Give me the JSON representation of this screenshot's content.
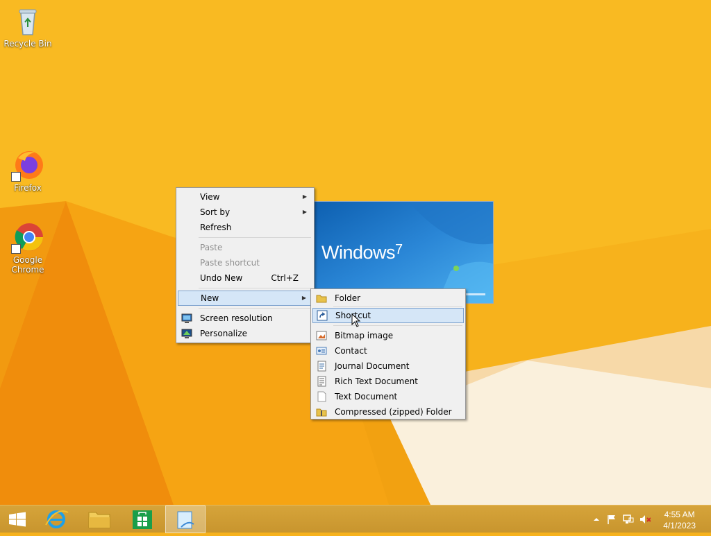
{
  "desktop": {
    "icons": [
      {
        "label": "Recycle Bin"
      },
      {
        "label": "Firefox"
      },
      {
        "label": "Google Chrome"
      }
    ],
    "preview_text": "Windows",
    "preview_version": "7"
  },
  "context_menu": {
    "items": [
      {
        "label": "View",
        "has_submenu": true
      },
      {
        "label": "Sort by",
        "has_submenu": true
      },
      {
        "label": "Refresh"
      },
      {
        "label": "Paste",
        "disabled": true
      },
      {
        "label": "Paste shortcut",
        "disabled": true
      },
      {
        "label": "Undo New",
        "shortcut": "Ctrl+Z"
      },
      {
        "label": "New",
        "has_submenu": true,
        "highlighted": true
      },
      {
        "label": "Screen resolution",
        "icon": "screen-resolution-icon"
      },
      {
        "label": "Personalize",
        "icon": "personalize-icon"
      }
    ]
  },
  "new_submenu": {
    "items": [
      {
        "label": "Folder",
        "icon": "folder-icon"
      },
      {
        "label": "Shortcut",
        "icon": "shortcut-icon",
        "highlighted": true
      },
      {
        "label": "Bitmap image",
        "icon": "bitmap-icon"
      },
      {
        "label": "Contact",
        "icon": "contact-icon"
      },
      {
        "label": "Journal Document",
        "icon": "journal-icon"
      },
      {
        "label": "Rich Text Document",
        "icon": "rich-text-icon"
      },
      {
        "label": "Text Document",
        "icon": "text-document-icon"
      },
      {
        "label": "Compressed (zipped) Folder",
        "icon": "zip-folder-icon"
      }
    ]
  },
  "taskbar": {
    "buttons": [
      "start-button",
      "internet-explorer",
      "file-explorer",
      "store",
      "active-app"
    ],
    "clock_time": "4:55 AM",
    "clock_date": "4/1/2023"
  },
  "colors": {
    "desktop": "#f7b21c",
    "menu_bg": "#f0f0f0",
    "highlight": "#d5e6f7"
  }
}
